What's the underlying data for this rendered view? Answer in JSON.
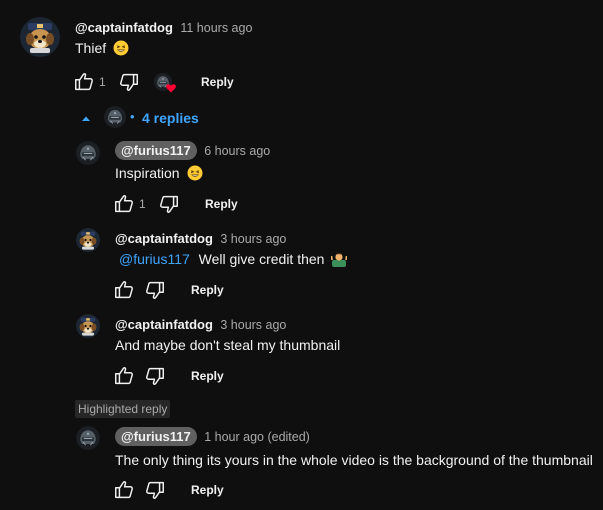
{
  "comments": [
    {
      "author": "@captainfatdog",
      "time": "11 hours ago",
      "text": "Thief",
      "likes": "1",
      "reply_label": "Reply",
      "highlight_author": false
    },
    {
      "author": "@furius117",
      "time": "6 hours ago",
      "text": "Inspiration",
      "likes": "1",
      "reply_label": "Reply",
      "highlight_author": true
    },
    {
      "author": "@captainfatdog",
      "time": "3 hours ago",
      "mention": "@furius117",
      "text": "Well give credit then",
      "reply_label": "Reply",
      "highlight_author": false
    },
    {
      "author": "@captainfatdog",
      "time": "3 hours ago",
      "text": "And maybe don't steal my thumbnail",
      "reply_label": "Reply",
      "highlight_author": false
    },
    {
      "author": "@furius117",
      "time": "1 hour ago (edited)",
      "text": "The only thing its yours in the whole video is the background of the thumbnail",
      "reply_label": "Reply",
      "highlight_author": true
    }
  ],
  "replies_toggle": {
    "separator": "•",
    "count_label": "4 replies"
  },
  "highlighted_badge": "Highlighted reply",
  "colors": {
    "background": "#0f0f0f",
    "accent": "#3ea6ff",
    "heart": "#ff0033",
    "pill": "#606060"
  },
  "icons": [
    "dog-avatar",
    "helmet-avatar",
    "thumbs-up-icon",
    "thumbs-down-icon",
    "creator-heart-icon",
    "caret-up-icon",
    "grin-emoji",
    "shrug-emoji"
  ]
}
